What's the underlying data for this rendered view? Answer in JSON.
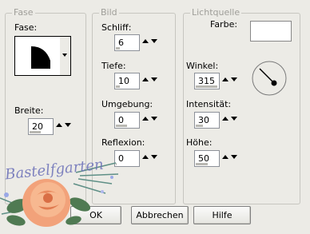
{
  "groups": {
    "fase": {
      "legend": "Fase",
      "label": "Fase:",
      "breite_label": "Breite:",
      "breite_value": "20"
    },
    "bild": {
      "legend": "Bild",
      "schliff_label": "Schliff:",
      "schliff_value": "6",
      "tiefe_label": "Tiefe:",
      "tiefe_value": "10",
      "umgebung_label": "Umgebung:",
      "umgebung_value": "0",
      "reflexion_label": "Reflexion:",
      "reflexion_value": "0"
    },
    "lichtquelle": {
      "legend": "Lichtquelle",
      "farbe_label": "Farbe:",
      "farbe_color": "#ffffff",
      "winkel_label": "Winkel:",
      "winkel_value": "315",
      "intensitaet_label": "Intensität:",
      "intensitaet_value": "30",
      "hoehe_label": "Höhe:",
      "hoehe_value": "50"
    }
  },
  "buttons": {
    "ok": "OK",
    "abbrechen": "Abbrechen",
    "hilfe": "Hilfe"
  },
  "watermark": {
    "text": "Bastelfgarten"
  }
}
